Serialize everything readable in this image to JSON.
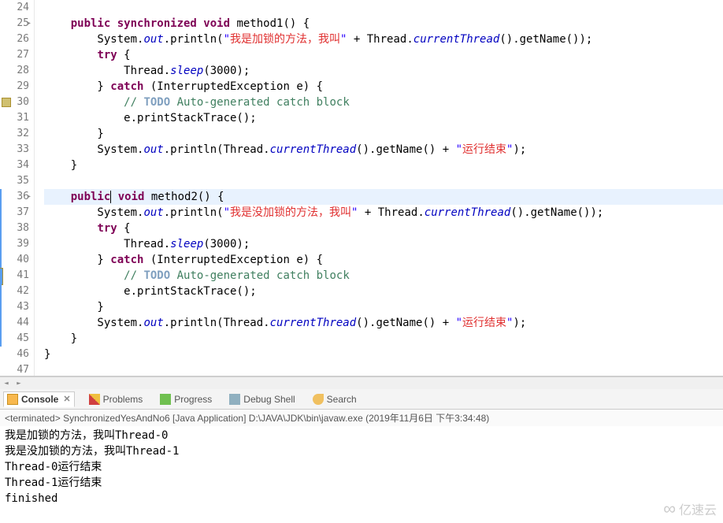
{
  "editor": {
    "lines": [
      {
        "n": "24",
        "cls": "",
        "html": ""
      },
      {
        "n": "25",
        "cls": "arr",
        "html": "    <span class='kw'>public synchronized void</span> method1() {"
      },
      {
        "n": "26",
        "cls": "",
        "html": "        System.<span class='fld'>out</span>.println(<span class='str'>\"</span><span class='str-cn'>我是加锁的方法，我叫</span><span class='str'>\"</span> + Thread.<span class='fld'>currentThread</span>().getName());"
      },
      {
        "n": "27",
        "cls": "",
        "html": "        <span class='kw'>try</span> {"
      },
      {
        "n": "28",
        "cls": "",
        "html": "            Thread.<span class='fld'>sleep</span>(3000);"
      },
      {
        "n": "29",
        "cls": "",
        "html": "        } <span class='kw'>catch</span> (InterruptedException e) {"
      },
      {
        "n": "30",
        "cls": "cp",
        "html": "            <span class='cmt'>// </span><span class='todo'>TODO</span><span class='cmt'> Auto-generated catch block</span>"
      },
      {
        "n": "31",
        "cls": "",
        "html": "            e.printStackTrace();"
      },
      {
        "n": "32",
        "cls": "",
        "html": "        }"
      },
      {
        "n": "33",
        "cls": "",
        "html": "        System.<span class='fld'>out</span>.println(Thread.<span class='fld'>currentThread</span>().getName() + <span class='str'>\"</span><span class='str-cn'>运行结束</span><span class='str'>\"</span>);"
      },
      {
        "n": "34",
        "cls": "",
        "html": "    }"
      },
      {
        "n": "35",
        "cls": "",
        "html": ""
      },
      {
        "n": "36",
        "cls": "m arr",
        "hl": true,
        "html": "    <span class='kw'>public</span><span class='cursor'></span> <span class='kw'>void</span> method2() {"
      },
      {
        "n": "37",
        "cls": "m",
        "html": "        System.<span class='fld'>out</span>.println(<span class='str'>\"</span><span class='str-cn'>我是没加锁的方法，我叫</span><span class='str'>\"</span> + Thread.<span class='fld'>currentThread</span>().getName());"
      },
      {
        "n": "38",
        "cls": "m",
        "html": "        <span class='kw'>try</span> {"
      },
      {
        "n": "39",
        "cls": "m",
        "html": "            Thread.<span class='fld'>sleep</span>(3000);"
      },
      {
        "n": "40",
        "cls": "m",
        "html": "        } <span class='kw'>catch</span> (InterruptedException e) {"
      },
      {
        "n": "41",
        "cls": "m cp",
        "html": "            <span class='cmt'>// </span><span class='todo'>TODO</span><span class='cmt'> Auto-generated catch block</span>"
      },
      {
        "n": "42",
        "cls": "m",
        "html": "            e.printStackTrace();"
      },
      {
        "n": "43",
        "cls": "m",
        "html": "        }"
      },
      {
        "n": "44",
        "cls": "m",
        "html": "        System.<span class='fld'>out</span>.println(Thread.<span class='fld'>currentThread</span>().getName() + <span class='str'>\"</span><span class='str-cn'>运行结束</span><span class='str'>\"</span>);"
      },
      {
        "n": "45",
        "cls": "m",
        "html": "    }"
      },
      {
        "n": "46",
        "cls": "",
        "html": "}"
      },
      {
        "n": "47",
        "cls": "",
        "html": ""
      }
    ]
  },
  "tabs": {
    "console": "Console",
    "problems": "Problems",
    "progress": "Progress",
    "debugshell": "Debug Shell",
    "search": "Search"
  },
  "launch": {
    "status": "<terminated>",
    "name": "SynchronizedYesAndNo6 [Java Application]",
    "path": "D:\\JAVA\\JDK\\bin\\javaw.exe",
    "time": "(2019年11月6日 下午3:34:48)"
  },
  "console_output": [
    "我是加锁的方法，我叫Thread-0",
    "我是没加锁的方法，我叫Thread-1",
    "Thread-0运行结束",
    "Thread-1运行结束",
    "finished"
  ],
  "watermark": "亿速云"
}
